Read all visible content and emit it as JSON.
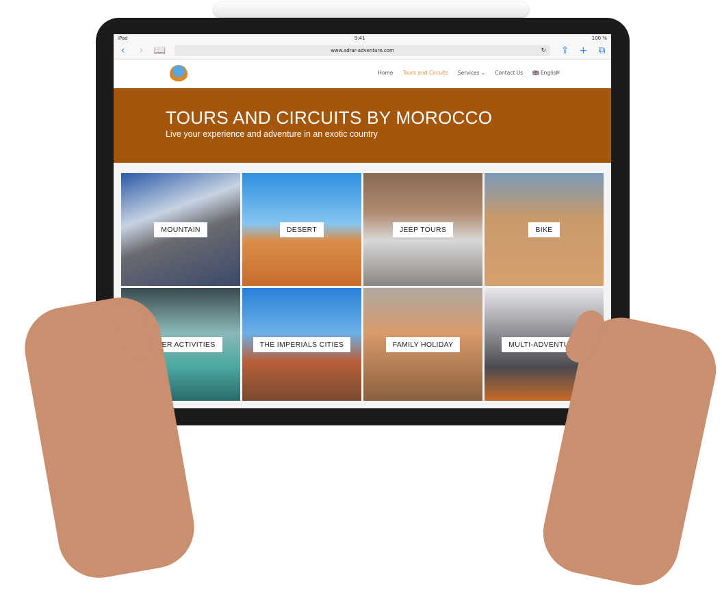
{
  "status_bar": {
    "device": "iPad",
    "time": "9:41",
    "battery": "100 %"
  },
  "browser": {
    "url": "www.adrar-adventure.com"
  },
  "nav": {
    "items": [
      {
        "label": "Home"
      },
      {
        "label": "Tours and Circuits",
        "active": true
      },
      {
        "label": "Services ⌄"
      },
      {
        "label": "Contact Us"
      },
      {
        "label": "🇬🇧 English"
      }
    ]
  },
  "banner": {
    "title": "TOURS AND CIRCUITS BY MOROCCO",
    "subtitle": "Live your experience and adventure in an exotic country",
    "color": "#a4560b"
  },
  "tiles": [
    {
      "label": "MOUNTAIN",
      "bg": "linear-gradient(160deg,#2a5aa8 0%,#c7d3e2 35%,#6a6a70 55%,#3b4a6a 100%)"
    },
    {
      "label": "DESERT",
      "bg": "linear-gradient(180deg,#2f8fe0 0%,#86c4f0 45%,#d98e4a 60%,#c86c2c 100%)"
    },
    {
      "label": "JEEP TOURS",
      "bg": "linear-gradient(180deg,#8a6a55 0%,#b08a70 35%,#d8d8d8 60%,#8a8580 100%)"
    },
    {
      "label": "BIKE",
      "bg": "linear-gradient(180deg,#7a9ab8 0%,#c89a6a 40%,#d6a070 100%)"
    },
    {
      "label": "WATER ACTIVITIES",
      "bg": "linear-gradient(180deg,#3a4a50 0%,#8ab8b8 40%,#4aa8a0 70%,#2a6a6a 100%)"
    },
    {
      "label": "THE IMPERIALS CITIES",
      "bg": "linear-gradient(180deg,#2a7fd8 0%,#6ab0e8 40%,#b8603a 65%,#7a4a30 100%)"
    },
    {
      "label": "FAMILY HOLIDAY",
      "bg": "linear-gradient(180deg,#b0a8a0 0%,#d89a6a 40%,#8a6040 100%)"
    },
    {
      "label": "MULTI-ADVENTURE",
      "bg": "linear-gradient(180deg,#e8e8ec 0%,#9a9aa0 35%,#4a4a50 70%,#c86a2a 100%)"
    }
  ]
}
